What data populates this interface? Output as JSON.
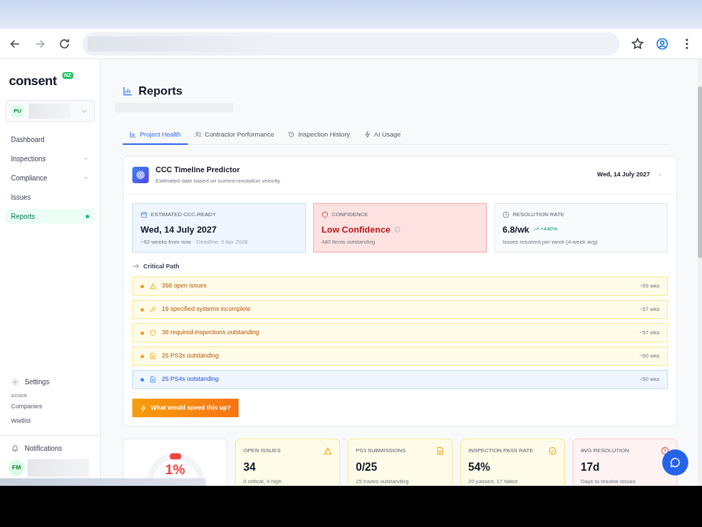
{
  "sidebar": {
    "logo": "consent",
    "region_badge": "NZ",
    "project": {
      "initials": "PU"
    },
    "nav": [
      {
        "label": "Dashboard",
        "expandable": false,
        "selected": false
      },
      {
        "label": "Inspections",
        "expandable": true,
        "selected": false
      },
      {
        "label": "Compliance",
        "expandable": true,
        "selected": false
      },
      {
        "label": "Issues",
        "expandable": false,
        "selected": false
      },
      {
        "label": "Reports",
        "expandable": false,
        "selected": true
      }
    ],
    "settings": "Settings",
    "admin_heading": "ADMIN",
    "admin_links": [
      "Companies",
      "Waitlist"
    ],
    "notifications": "Notifications",
    "user": {
      "initials": "FM"
    }
  },
  "page": {
    "title": "Reports",
    "tabs": [
      {
        "label": "Project Health",
        "selected": true
      },
      {
        "label": "Contractor Performance",
        "selected": false
      },
      {
        "label": "Inspection History",
        "selected": false
      },
      {
        "label": "AI Usage",
        "selected": false
      }
    ],
    "predictor": {
      "title": "CCC Timeline Predictor",
      "subtitle": "Estimated date based on current resolution velocity",
      "header_date": "Wed, 14 July 2027",
      "expanded": true,
      "cards": [
        {
          "kind": "info",
          "label": "ESTIMATED CCC-READY",
          "value": "Wed, 14 July 2027",
          "note": "~62 weeks from now",
          "deadline": "· Deadline: 9 Apr 2028"
        },
        {
          "kind": "danger",
          "label": "CONFIDENCE",
          "value": "Low Confidence",
          "note": "480 items outstanding"
        },
        {
          "kind": "neutral",
          "label": "RESOLUTION RATE",
          "value": "6.8/wk",
          "trend": "+440%",
          "note": "Issues resolved per week (4-week avg)"
        }
      ],
      "critical_path_heading": "Critical Path",
      "critical_path": [
        {
          "kind": "warning",
          "color": "#f59e0b",
          "label": "398 open issues",
          "eta": "~59 wks"
        },
        {
          "kind": "warning",
          "color": "#f59e0b",
          "label": "19 specified systems incomplete",
          "eta": "~57 wks"
        },
        {
          "kind": "warning",
          "color": "#f59e0b",
          "label": "38 required inspections outstanding",
          "eta": "~57 wks"
        },
        {
          "kind": "warning",
          "color": "#f59e0b",
          "label": "25 PS3s outstanding",
          "eta": "~50 wks"
        },
        {
          "kind": "info",
          "color": "#3b82f6",
          "label": "25 PS4s outstanding",
          "eta": "~50 wks"
        }
      ],
      "action_button": "What would speed this up?"
    },
    "gauge": {
      "reading": "1%"
    },
    "stats": [
      {
        "kind": "warning",
        "label": "OPEN ISSUES",
        "value": "34",
        "note": "0 critical, 9 high"
      },
      {
        "kind": "warning",
        "label": "PS3 SUBMISSIONS",
        "value": "0/25",
        "note": "25 trades outstanding"
      },
      {
        "kind": "warning",
        "label": "INSPECTION PASS RATE",
        "value": "54%",
        "note": "20 passed, 17 failed"
      },
      {
        "kind": "danger",
        "label": "AVG RESOLUTION",
        "value": "17d",
        "note": "Days to resolve issues"
      }
    ]
  }
}
